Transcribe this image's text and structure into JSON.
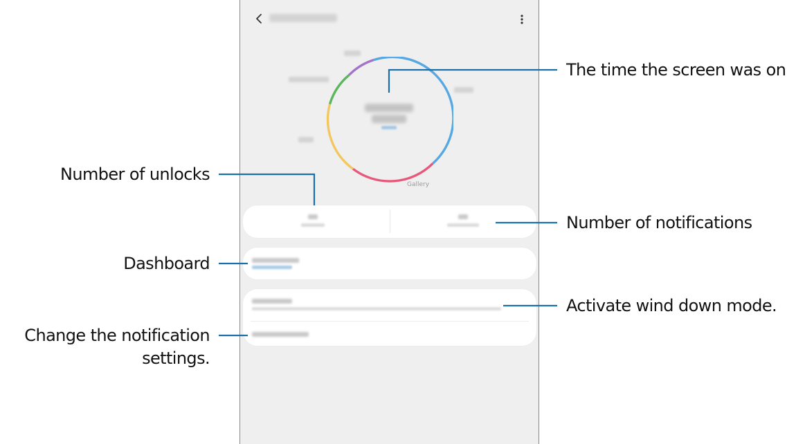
{
  "annotations": {
    "screen_time": "The time the screen was on",
    "unlocks": "Number of unlocks",
    "notifications": "Number of notifications",
    "dashboard": "Dashboard",
    "wind_down": "Activate wind down mode.",
    "notif_settings_line1": "Change the notification",
    "notif_settings_line2": "settings."
  },
  "screen": {
    "chart_label_gallery": "Gallery"
  },
  "colors": {
    "ring_blue": "#56a7e2",
    "ring_red": "#e8587a",
    "ring_yellow": "#f2c75d",
    "ring_green": "#5ab75c",
    "ring_purple": "#a372c9",
    "callout_line": "#1b6fa8"
  },
  "icons": {
    "back": "chevron-left-icon",
    "more": "more-vertical-icon"
  }
}
